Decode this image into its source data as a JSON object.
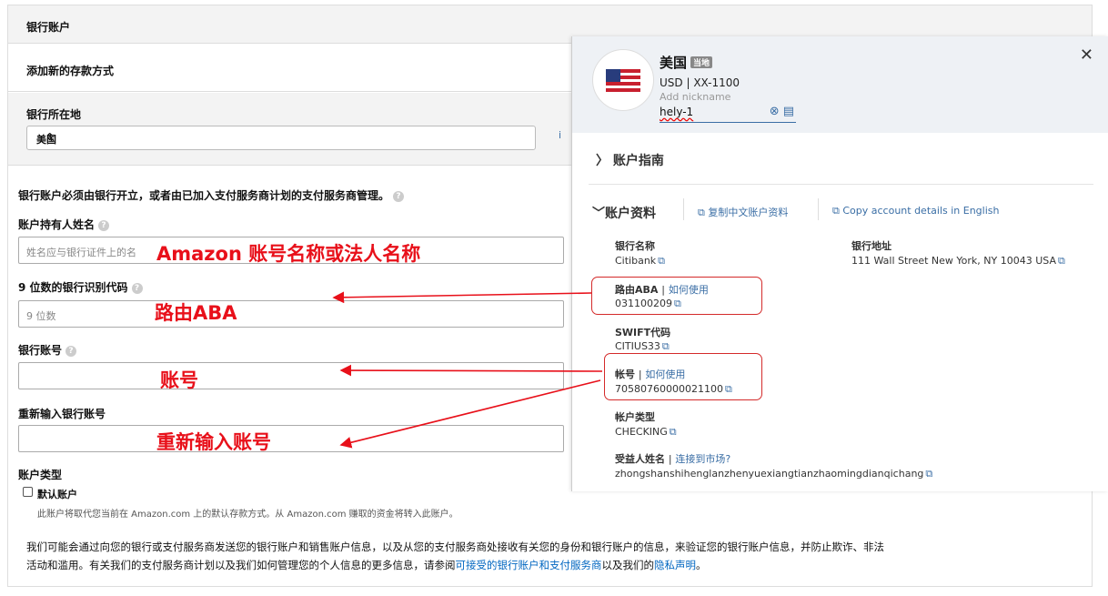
{
  "form": {
    "section_title": "银行账户",
    "add_method": "添加新的存款方式",
    "location_label": "银行所在地",
    "location_value": "美国",
    "notice": "银行账户必须由银行开立，或者由已加入支付服务商计划的支付服务商管理。",
    "holder_label": "账户持有人姓名",
    "holder_placeholder": "姓名应与银行证件上的名",
    "routing_label": "9 位数的银行识别代码",
    "routing_placeholder": "9 位数",
    "account_label": "银行账号",
    "reenter_label": "重新输入银行账号",
    "type_label": "账户类型",
    "default_label": "默认账户",
    "default_note": "此账户将取代您当前在 Amazon.com 上的默认存款方式。从 Amazon.com 赚取的资金将转入此账户。",
    "disclosure_1": "我们可能会通过向您的银行或支付服务商发送您的银行账户和销售账户信息，以及从您的支付服务商处接收有关您的身份和银行账户的信息，来验证您的银行账户信息，并防止欺诈、非法",
    "disclosure_2a": "活动和滥用。有关我们的支付服务商计划以及我们如何管理您的个人信息的更多信息，请参阅",
    "disclosure_link1": "可接受的银行账户和支付服务商",
    "disclosure_2b": "以及我们的",
    "disclosure_link2": "隐私声明",
    "disclosure_2c": "。"
  },
  "annotations": {
    "holder": "Amazon 账号名称或法人名称",
    "routing": "路由ABA",
    "account": "账号",
    "reenter": "重新输入账号"
  },
  "panel": {
    "country": "美国",
    "badge": "当地",
    "currency_line": "USD | XX-1100",
    "nickname_label": "Add nickname",
    "nickname_value": "hely-1",
    "close": "✕",
    "guide": "账户指南",
    "details": "账户资料",
    "copy_cn": "复制中文账户资料",
    "copy_en": "Copy account details in English",
    "bank_name_label": "银行名称",
    "bank_name_value": "Citibank",
    "bank_addr_label": "银行地址",
    "bank_addr_value": "111 Wall Street New York, NY 10043 USA",
    "aba_label": "路由ABA",
    "how_to_use": "如何使用",
    "aba_value": "031100209",
    "swift_label": "SWIFT代码",
    "swift_value": "CITIUS33",
    "acct_label": "帐号",
    "acct_value": "70580760000021100",
    "acct_type_label": "帐户类型",
    "acct_type_value": "CHECKING",
    "beneficiary_label": "受益人姓名",
    "connect_market": "连接到市场?",
    "beneficiary_value": "zhongshanshihenglanzhenyuexiangtianzhaomingdianqichang"
  },
  "colors": {
    "annotation_red": "#e8101a",
    "link_blue": "#3a6ea5"
  }
}
